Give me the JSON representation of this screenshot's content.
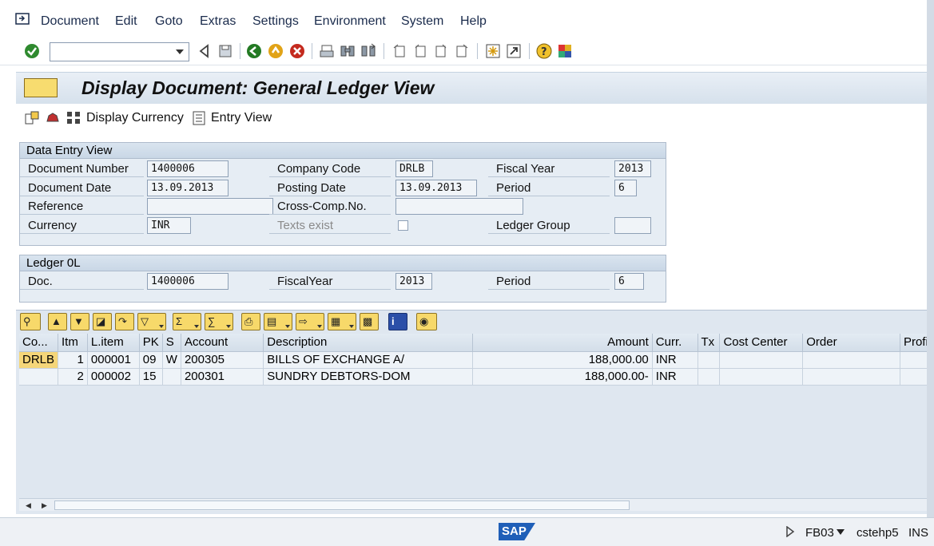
{
  "menubar": {
    "items": [
      "Document",
      "Edit",
      "Goto",
      "Extras",
      "Settings",
      "Environment",
      "System",
      "Help"
    ]
  },
  "toolbar": {
    "command_field_value": ""
  },
  "title": "Display Document: General Ledger View",
  "app_toolbar": {
    "display_currency_label": "Display Currency",
    "entry_view_label": "Entry View"
  },
  "data_entry_view": {
    "heading": "Data Entry View",
    "document_number_label": "Document Number",
    "document_number": "1400006",
    "company_code_label": "Company Code",
    "company_code": "DRLB",
    "fiscal_year_label": "Fiscal Year",
    "fiscal_year": "2013",
    "document_date_label": "Document Date",
    "document_date": "13.09.2013",
    "posting_date_label": "Posting Date",
    "posting_date": "13.09.2013",
    "period_label": "Period",
    "period": "6",
    "reference_label": "Reference",
    "reference": "",
    "cross_comp_label": "Cross-Comp.No.",
    "cross_comp": "",
    "currency_label": "Currency",
    "currency": "INR",
    "texts_exist_label": "Texts exist",
    "ledger_group_label": "Ledger Group",
    "ledger_group": ""
  },
  "ledger": {
    "heading": "Ledger 0L",
    "doc_label": "Doc.",
    "doc": "1400006",
    "fiscal_year_label": "FiscalYear",
    "fiscal_year": "2013",
    "period_label": "Period",
    "period": "6"
  },
  "grid": {
    "columns": [
      "Co...",
      "Itm",
      "L.item",
      "PK",
      "S",
      "Account",
      "Description",
      "Amount",
      "Curr.",
      "Tx",
      "Cost Center",
      "Order",
      "Profi"
    ],
    "rows": [
      {
        "co": "DRLB",
        "itm": "1",
        "litem": "000001",
        "pk": "09",
        "s": "W",
        "account": "200305",
        "description": "BILLS OF EXCHANGE A/",
        "amount": "188,000.00",
        "curr": "INR",
        "tx": "",
        "cost_center": "",
        "order": "",
        "profit": ""
      },
      {
        "co": "",
        "itm": "2",
        "litem": "000002",
        "pk": "15",
        "s": "",
        "account": "200301",
        "description": "SUNDRY DEBTORS-DOM",
        "amount": "188,000.00-",
        "curr": "INR",
        "tx": "",
        "cost_center": "",
        "order": "",
        "profit": ""
      }
    ]
  },
  "statusbar": {
    "logo": "SAP",
    "transaction": "FB03",
    "server": "cstehp5",
    "mode": "INS"
  }
}
